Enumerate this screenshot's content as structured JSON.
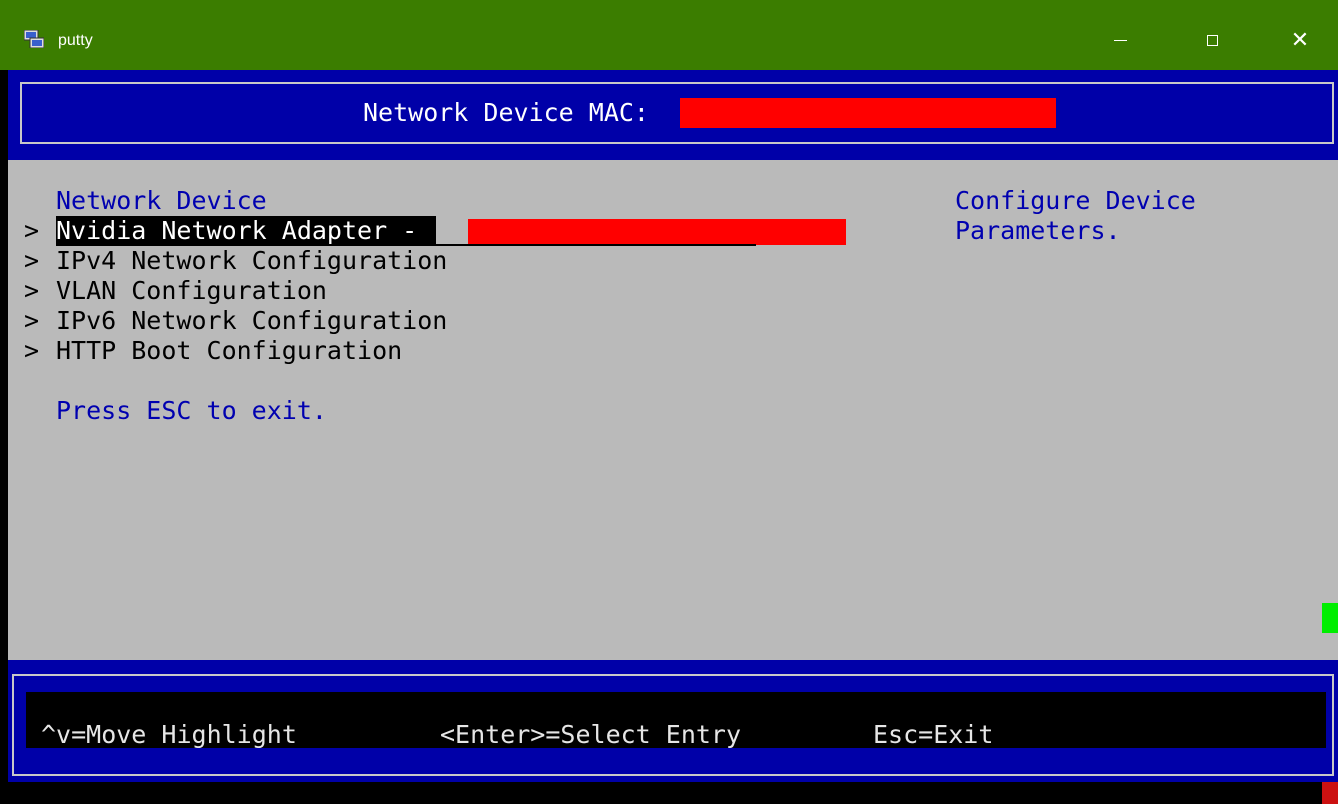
{
  "window": {
    "title": "putty",
    "app_icon": "putty-icon",
    "minimize_icon": "minimize-icon",
    "maximize_icon": "maximize-icon",
    "close_glyph": "✕"
  },
  "header": {
    "label": "Network Device MAC:",
    "mac_redacted": true
  },
  "menu": {
    "section_title": "Network Device",
    "arrow": ">",
    "items": [
      {
        "label": "Nvidia Network Adapter - ",
        "selected": true,
        "redacted_suffix": true
      },
      {
        "label": "IPv4 Network Configuration",
        "selected": false
      },
      {
        "label": "VLAN Configuration",
        "selected": false
      },
      {
        "label": "IPv6 Network Configuration",
        "selected": false
      },
      {
        "label": "HTTP Boot Configuration",
        "selected": false
      }
    ],
    "exit_hint": "Press ESC to exit."
  },
  "help_panel": {
    "line1": "Configure Device",
    "line2": "Parameters."
  },
  "footer": {
    "move": "^v=Move Highlight",
    "select": "<Enter>=Select Entry",
    "exit": "Esc=Exit"
  },
  "colors": {
    "titlebar": "#3b7d00",
    "band_blue": "#0000a8",
    "content_gray": "#bababa",
    "text_blue": "#0000b0",
    "redaction": "#ff0000"
  }
}
